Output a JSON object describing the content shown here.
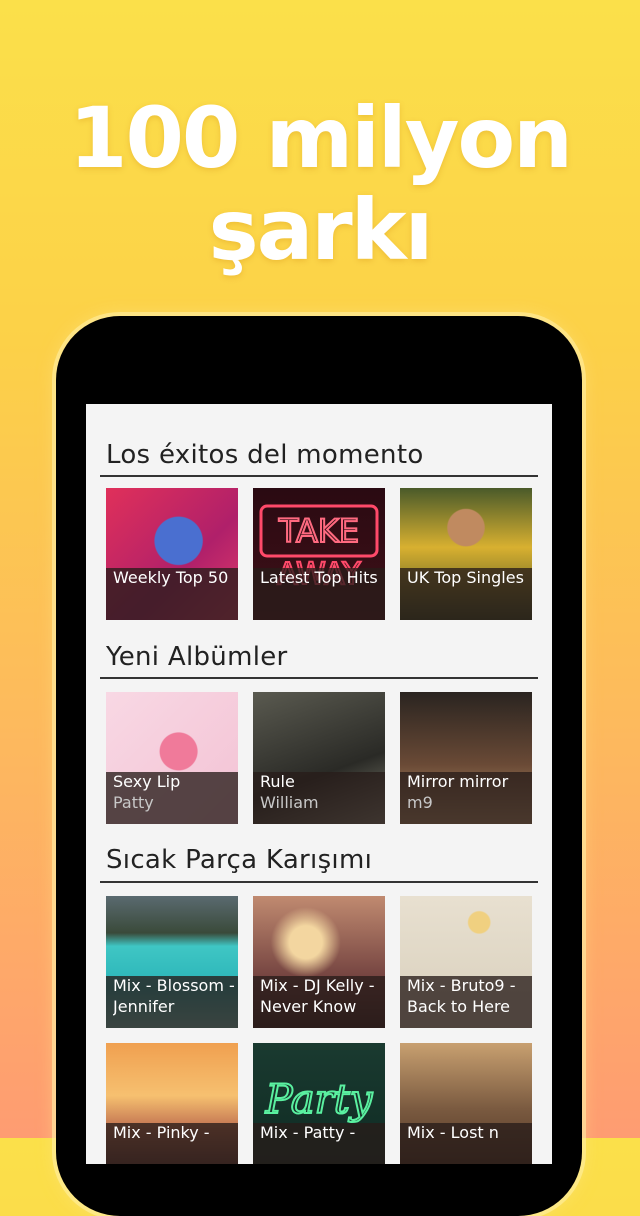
{
  "headline": {
    "line1": "100 milyon",
    "line2": "şarkı"
  },
  "sections": [
    {
      "title": "Los éxitos del momento",
      "items": [
        {
          "title": "Weekly Top 50",
          "subtitle": ""
        },
        {
          "title": "Latest Top Hits",
          "subtitle": ""
        },
        {
          "title": "UK Top Singles",
          "subtitle": ""
        }
      ]
    },
    {
      "title": "Yeni Albümler",
      "items": [
        {
          "title": "Sexy Lip",
          "subtitle": "Patty"
        },
        {
          "title": "Rule",
          "subtitle": "William"
        },
        {
          "title": "Mirror mirror",
          "subtitle": "m9"
        }
      ]
    },
    {
      "title": "Sıcak Parça Karışımı",
      "items": [
        {
          "title": "Mix - Blossom -",
          "subtitle": "Jennifer"
        },
        {
          "title": "Mix - DJ Kelly -",
          "subtitle": "Never Know"
        },
        {
          "title": "Mix - Bruto9 -",
          "subtitle": "Back to Here"
        },
        {
          "title": "Mix - Pinky -",
          "subtitle": ""
        },
        {
          "title": "Mix - Patty -",
          "subtitle": ""
        },
        {
          "title": "Mix - Lost n",
          "subtitle": ""
        }
      ]
    }
  ],
  "art_labels": {
    "neon_sign_top": "TAKE",
    "neon_sign_bottom": "AWAY",
    "neon_script": "Party"
  }
}
